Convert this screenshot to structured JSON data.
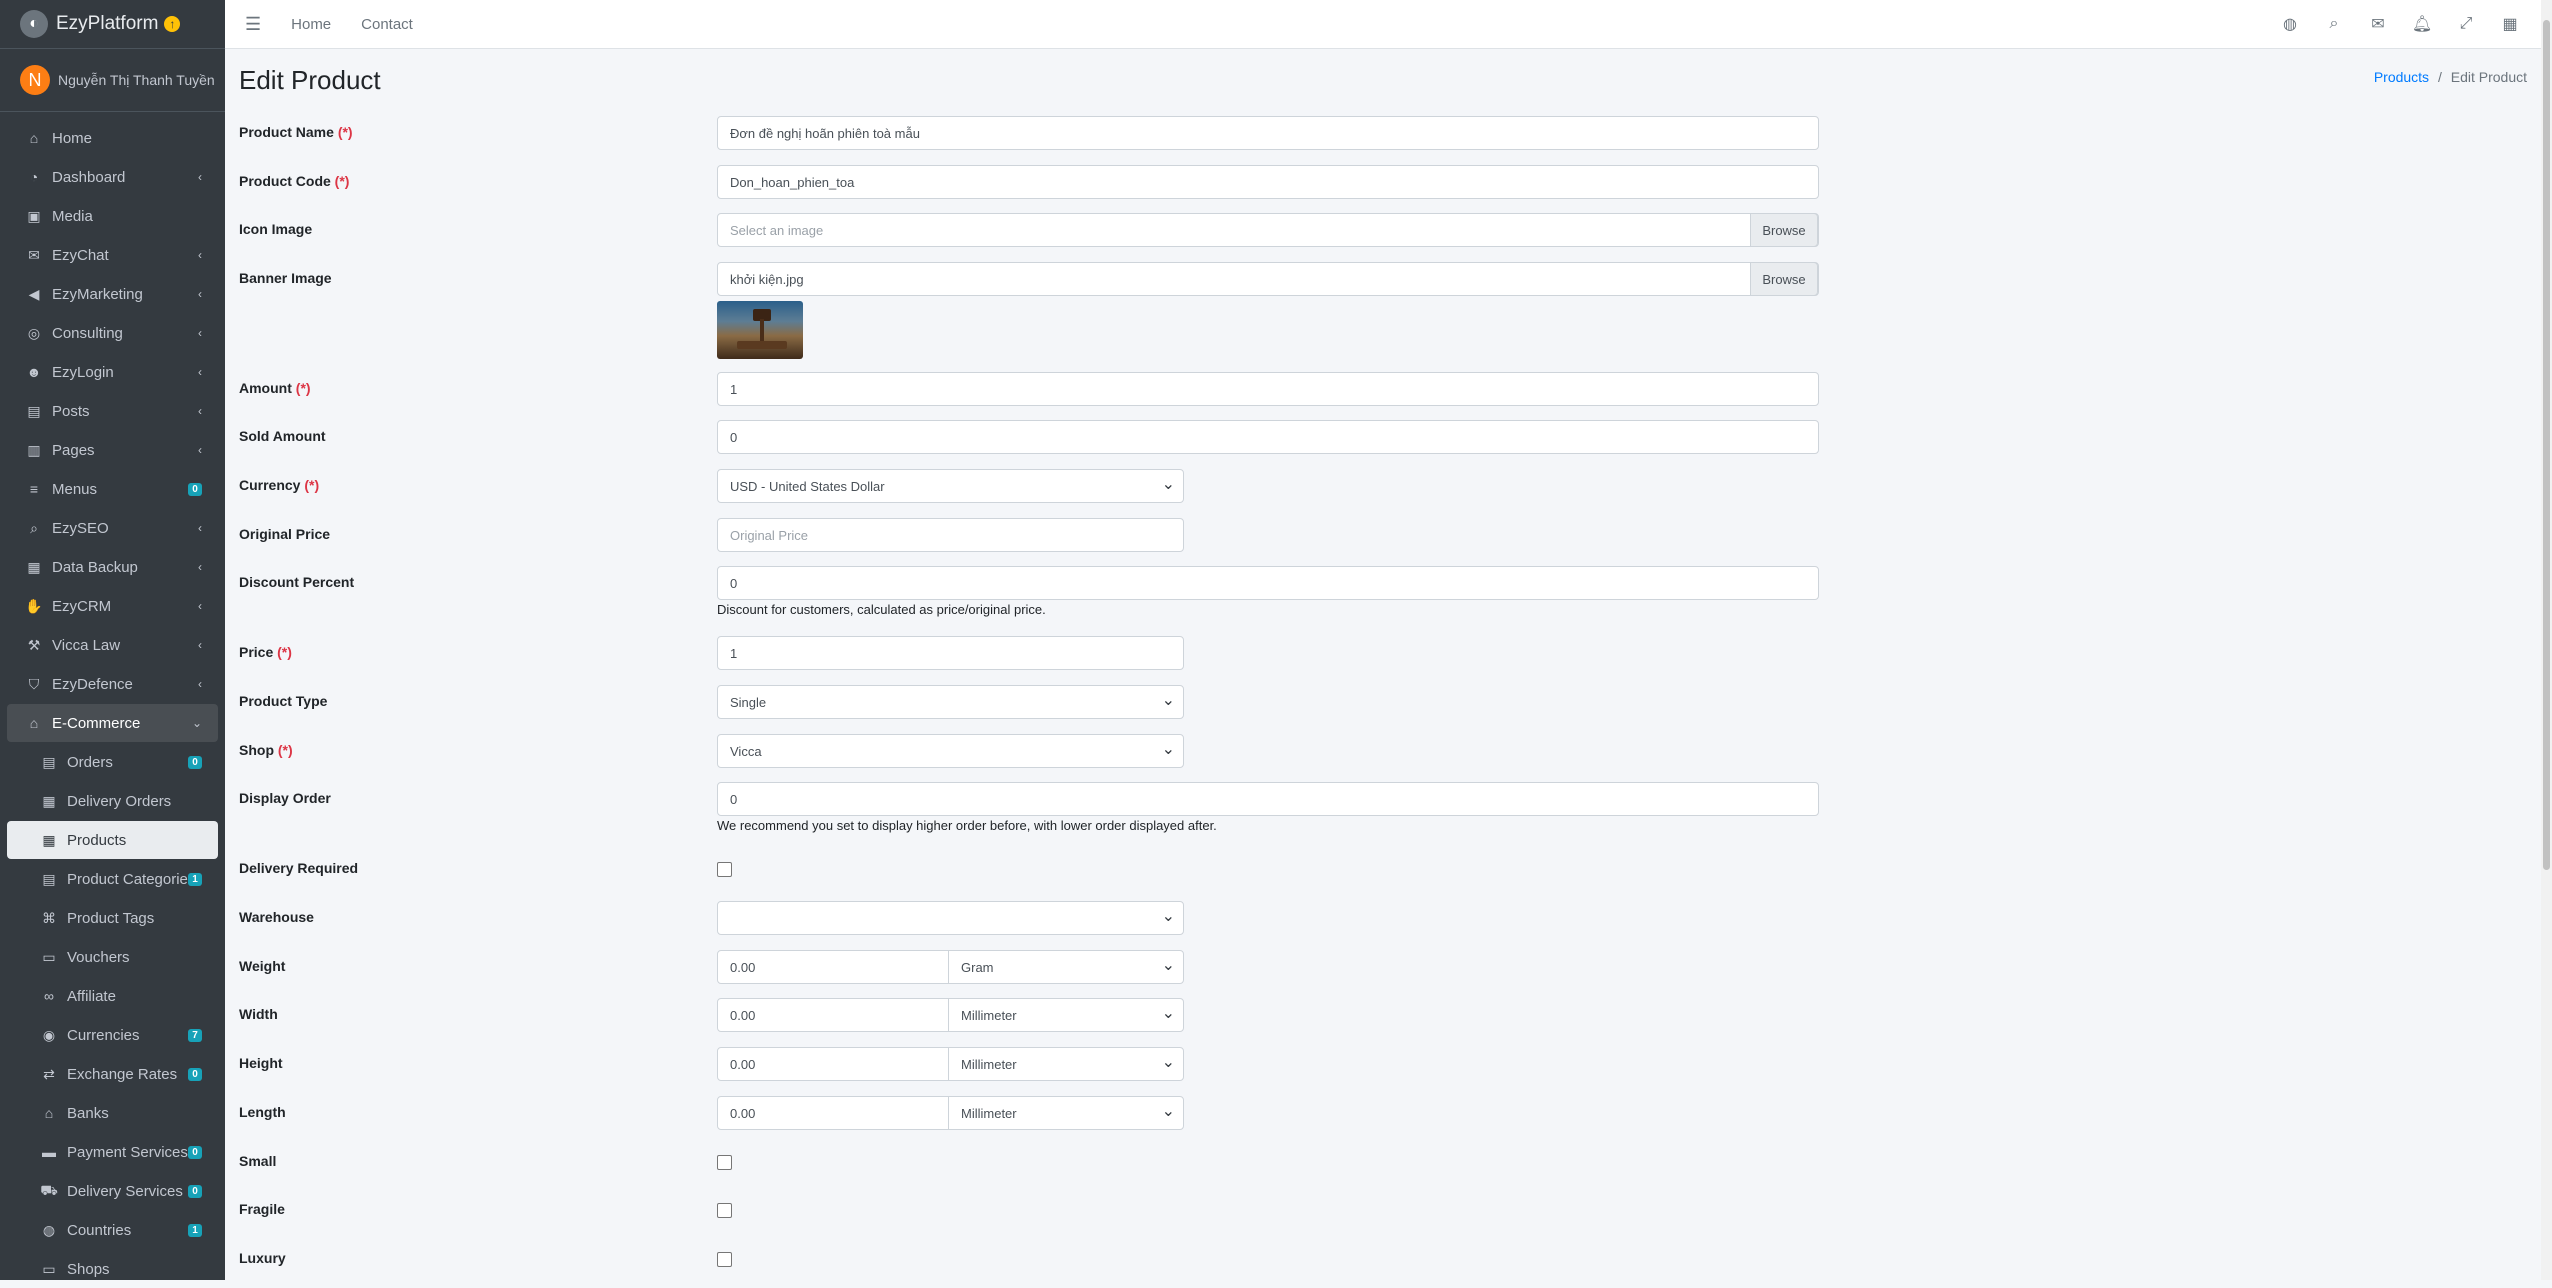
{
  "brand": {
    "name": "EzyPlatform"
  },
  "user": {
    "initial": "N",
    "name": "Nguyễn Thị Thanh Tuyền"
  },
  "nav": [
    {
      "label": "Home",
      "icon": "home-icon",
      "glyph": "⌂",
      "chev": false
    },
    {
      "label": "Dashboard",
      "icon": "dashboard-icon",
      "glyph": "◔",
      "chev": true
    },
    {
      "label": "Media",
      "icon": "image-icon",
      "glyph": "▣",
      "chev": false
    },
    {
      "label": "EzyChat",
      "icon": "chat-icon",
      "glyph": "✉",
      "chev": true
    },
    {
      "label": "EzyMarketing",
      "icon": "bullhorn-icon",
      "glyph": "◀",
      "chev": true
    },
    {
      "label": "Consulting",
      "icon": "headset-icon",
      "glyph": "◎",
      "chev": true
    },
    {
      "label": "EzyLogin",
      "icon": "user-lock-icon",
      "glyph": "☻",
      "chev": true
    },
    {
      "label": "Posts",
      "icon": "posts-icon",
      "glyph": "▤",
      "chev": true
    },
    {
      "label": "Pages",
      "icon": "pages-icon",
      "glyph": "▥",
      "chev": true
    },
    {
      "label": "Menus",
      "icon": "menu-icon",
      "glyph": "≡",
      "badge": "0"
    },
    {
      "label": "EzySEO",
      "icon": "search-icon",
      "glyph": "⌕",
      "chev": true
    },
    {
      "label": "Data Backup",
      "icon": "database-icon",
      "glyph": "▦",
      "chev": true
    },
    {
      "label": "EzyCRM",
      "icon": "handshake-icon",
      "glyph": "✋",
      "chev": true
    },
    {
      "label": "Vicca Law",
      "icon": "gavel-icon",
      "glyph": "⚒",
      "chev": true
    },
    {
      "label": "EzyDefence",
      "icon": "shield-icon",
      "glyph": "⛉",
      "chev": true
    },
    {
      "label": "E-Commerce",
      "icon": "store-icon",
      "glyph": "⌂",
      "open": true
    }
  ],
  "subnav": [
    {
      "label": "Orders",
      "icon": "orders-icon",
      "glyph": "▤",
      "badge": "0"
    },
    {
      "label": "Delivery Orders",
      "icon": "truck-loading-icon",
      "glyph": "▦"
    },
    {
      "label": "Products",
      "icon": "products-icon",
      "glyph": "▦",
      "active": true
    },
    {
      "label": "Product Categories",
      "icon": "clipboard-icon",
      "glyph": "▤",
      "badge": "1"
    },
    {
      "label": "Product Tags",
      "icon": "tags-icon",
      "glyph": "⌘"
    },
    {
      "label": "Vouchers",
      "icon": "ticket-icon",
      "glyph": "▭"
    },
    {
      "label": "Affiliate",
      "icon": "link-icon",
      "glyph": "∞"
    },
    {
      "label": "Currencies",
      "icon": "coins-icon",
      "glyph": "◉",
      "badge": "7"
    },
    {
      "label": "Exchange Rates",
      "icon": "exchange-icon",
      "glyph": "⇄",
      "badge": "0"
    },
    {
      "label": "Banks",
      "icon": "bank-icon",
      "glyph": "⌂"
    },
    {
      "label": "Payment Services",
      "icon": "credit-card-icon",
      "glyph": "▬",
      "badge": "0"
    },
    {
      "label": "Delivery Services",
      "icon": "truck-icon",
      "glyph": "⛟",
      "badge": "0"
    },
    {
      "label": "Countries",
      "icon": "globe-icon",
      "glyph": "◍",
      "badge": "1"
    },
    {
      "label": "Shops",
      "icon": "shop-icon",
      "glyph": "▭"
    }
  ],
  "topbar": {
    "home": "Home",
    "contact": "Contact"
  },
  "page": {
    "title": "Edit Product",
    "breadcrumb_parent": "Products",
    "breadcrumb_sep": "/",
    "breadcrumb_current": "Edit Product"
  },
  "form": {
    "product_name": {
      "label": "Product Name",
      "value": "Đơn đề nghị hoãn phiên toà mẫu"
    },
    "product_code": {
      "label": "Product Code",
      "value": "Don_hoan_phien_toa"
    },
    "icon_image": {
      "label": "Icon Image",
      "placeholder": "Select an image",
      "button": "Browse"
    },
    "banner_image": {
      "label": "Banner Image",
      "value": "khởi kiện.jpg",
      "button": "Browse"
    },
    "amount": {
      "label": "Amount",
      "value": "1"
    },
    "sold_amount": {
      "label": "Sold Amount",
      "value": "0"
    },
    "currency": {
      "label": "Currency",
      "value": "USD - United States Dollar"
    },
    "original_price": {
      "label": "Original Price",
      "placeholder": "Original Price"
    },
    "discount_percent": {
      "label": "Discount Percent",
      "value": "0",
      "help": "Discount for customers, calculated as price/original price."
    },
    "price": {
      "label": "Price",
      "value": "1"
    },
    "product_type": {
      "label": "Product Type",
      "value": "Single"
    },
    "shop": {
      "label": "Shop",
      "value": "Vicca"
    },
    "display_order": {
      "label": "Display Order",
      "value": "0",
      "help": "We recommend you set to display higher order before, with lower order displayed after."
    },
    "delivery_required": {
      "label": "Delivery Required"
    },
    "warehouse": {
      "label": "Warehouse",
      "value": ""
    },
    "weight": {
      "label": "Weight",
      "value": "0.00",
      "unit": "Gram"
    },
    "width": {
      "label": "Width",
      "value": "0.00",
      "unit": "Millimeter"
    },
    "height": {
      "label": "Height",
      "value": "0.00",
      "unit": "Millimeter"
    },
    "length": {
      "label": "Length",
      "value": "0.00",
      "unit": "Millimeter"
    },
    "small": {
      "label": "Small"
    },
    "fragile": {
      "label": "Fragile"
    },
    "luxury": {
      "label": "Luxury"
    },
    "required_mark": "(*)"
  },
  "colors": {
    "sidebar": "#343a40",
    "accent": "#007bff",
    "badge": "#17a2b8",
    "required": "#dc3545"
  }
}
